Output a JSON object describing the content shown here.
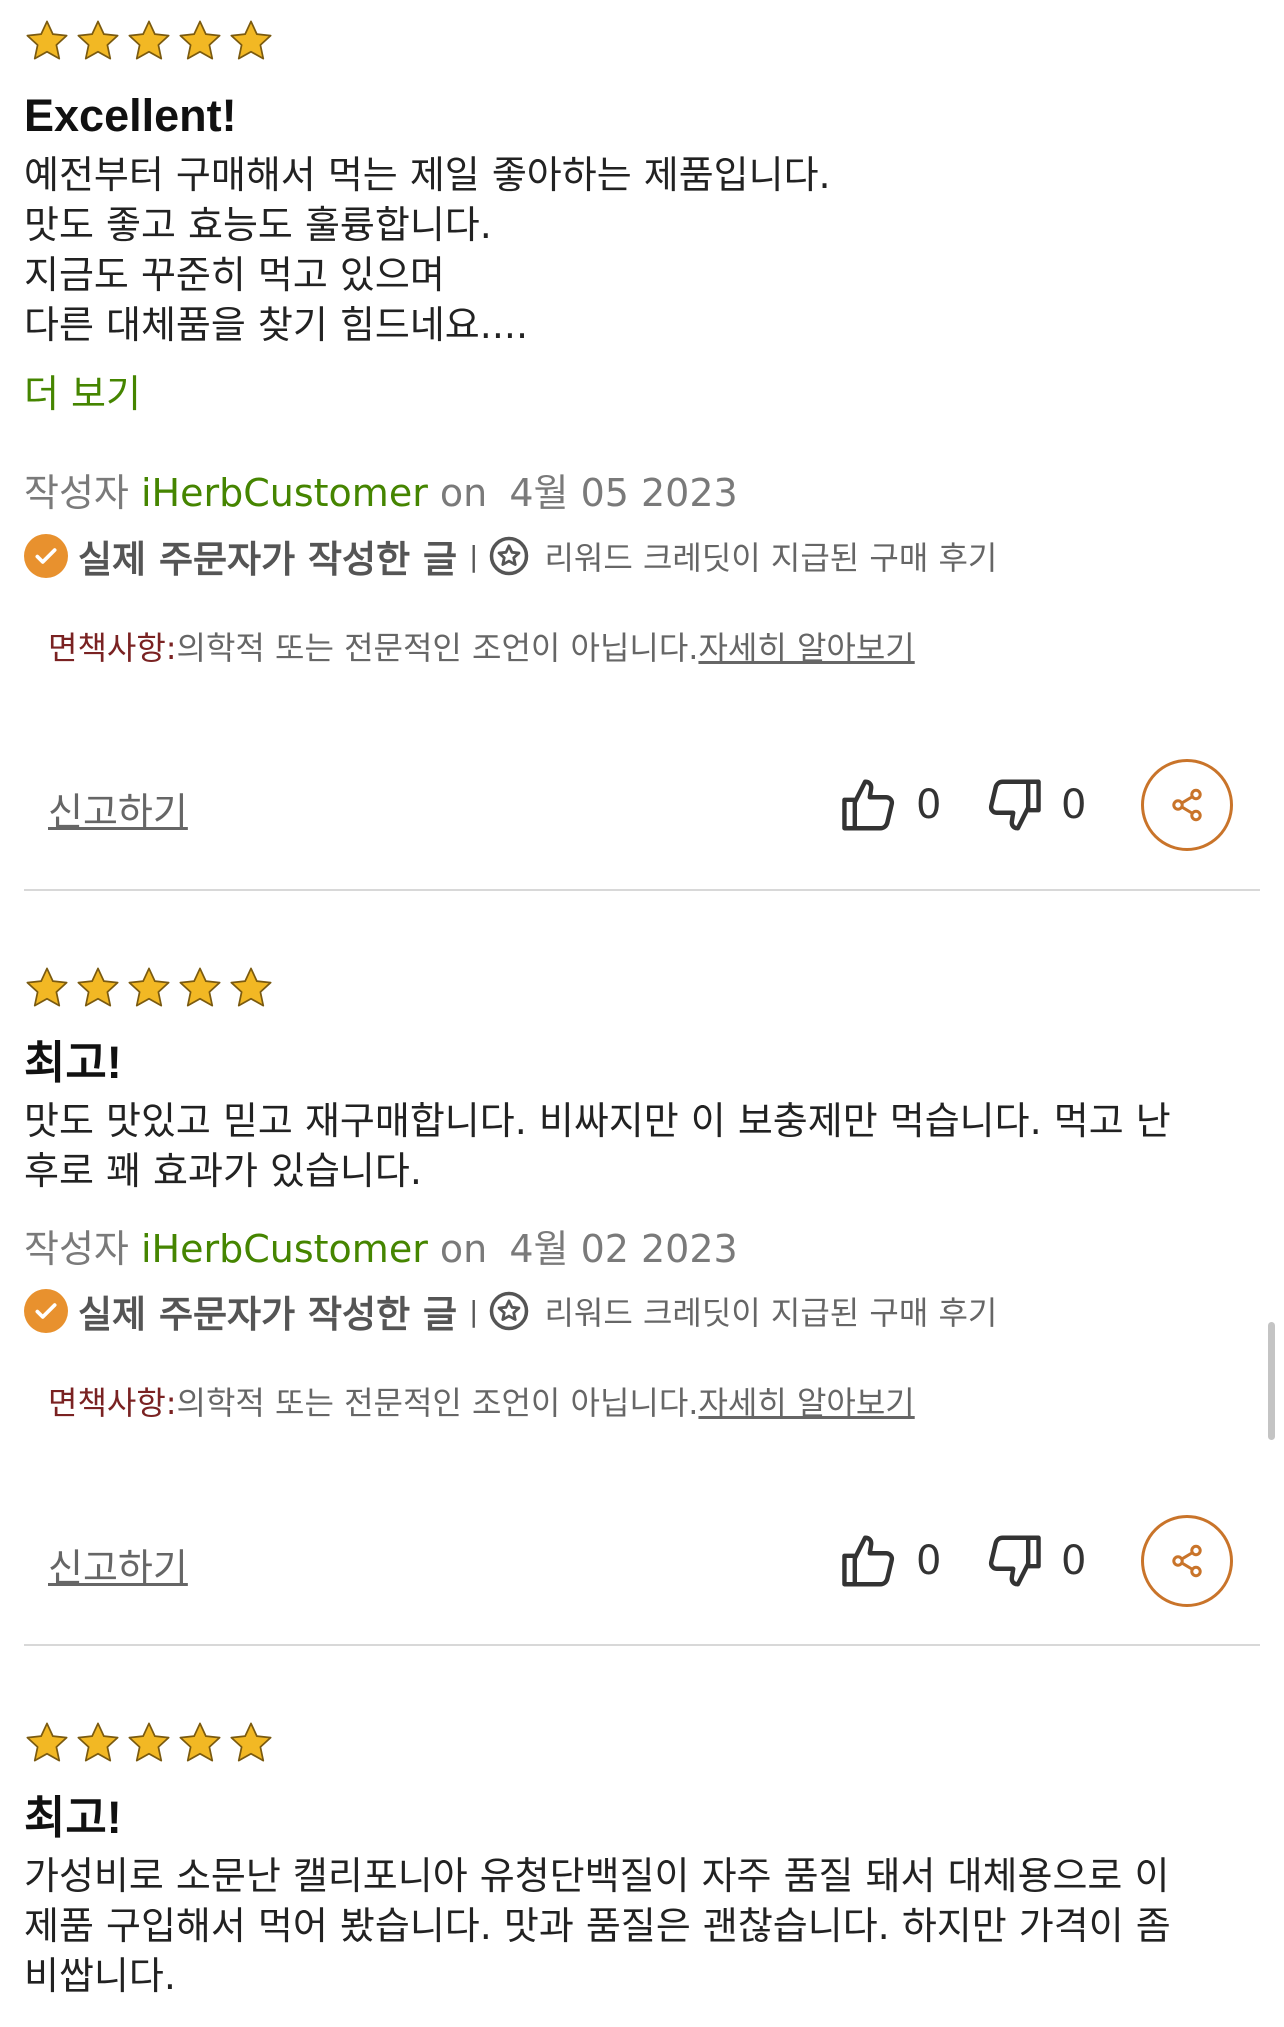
{
  "reviews": [
    {
      "rating": 5,
      "title": "Excellent!",
      "body_lines": [
        "예전부터 구매해서 먹는 제일 좋아하는 제품입니다.",
        "맛도 좋고 효능도 훌륭합니다.",
        "지금도 꾸준히 먹고 있으며",
        "다른 대체품을 찾기 힘드네요...."
      ],
      "more": "더 보기",
      "author_prefix": "작성자",
      "author": "iHerbCustomer",
      "on": "on",
      "date": "4월 05 2023",
      "verified": "실제 주문자가 작성한 글",
      "reward": "리워드 크레딧이 지급된 구매 후기",
      "disclaimer_label": "면책사항:",
      "disclaimer_text": "의학적 또는 전문적인 조언이 아닙니다.",
      "learn_more": "자세히 알아보기",
      "report": "신고하기",
      "likes": "0",
      "dislikes": "0"
    },
    {
      "rating": 5,
      "title": "최고!",
      "body_lines": [
        "맛도 맛있고 믿고 재구매합니다. 비싸지만 이 보충제만 먹습니다. 먹고 난",
        "후로 꽤 효과가 있습니다."
      ],
      "author_prefix": "작성자",
      "author": "iHerbCustomer",
      "on": "on",
      "date": "4월 02 2023",
      "verified": "실제 주문자가 작성한 글",
      "reward": "리워드 크레딧이 지급된 구매 후기",
      "disclaimer_label": "면책사항:",
      "disclaimer_text": "의학적 또는 전문적인 조언이 아닙니다.",
      "learn_more": "자세히 알아보기",
      "report": "신고하기",
      "likes": "0",
      "dislikes": "0"
    },
    {
      "rating": 5,
      "title": "최고!",
      "body_lines": [
        "가성비로 소문난 캘리포니아 유청단백질이 자주 품질 돼서 대체용으로 이",
        "제품 구입해서 먹어 봤습니다. 맛과 품질은 괜찮습니다. 하지만 가격이 좀",
        "비쌉니다."
      ]
    }
  ],
  "colors": {
    "star": "#f2b824",
    "accent_green": "#458500",
    "verified_orange": "#e8912e",
    "share_border": "#c9742a"
  }
}
